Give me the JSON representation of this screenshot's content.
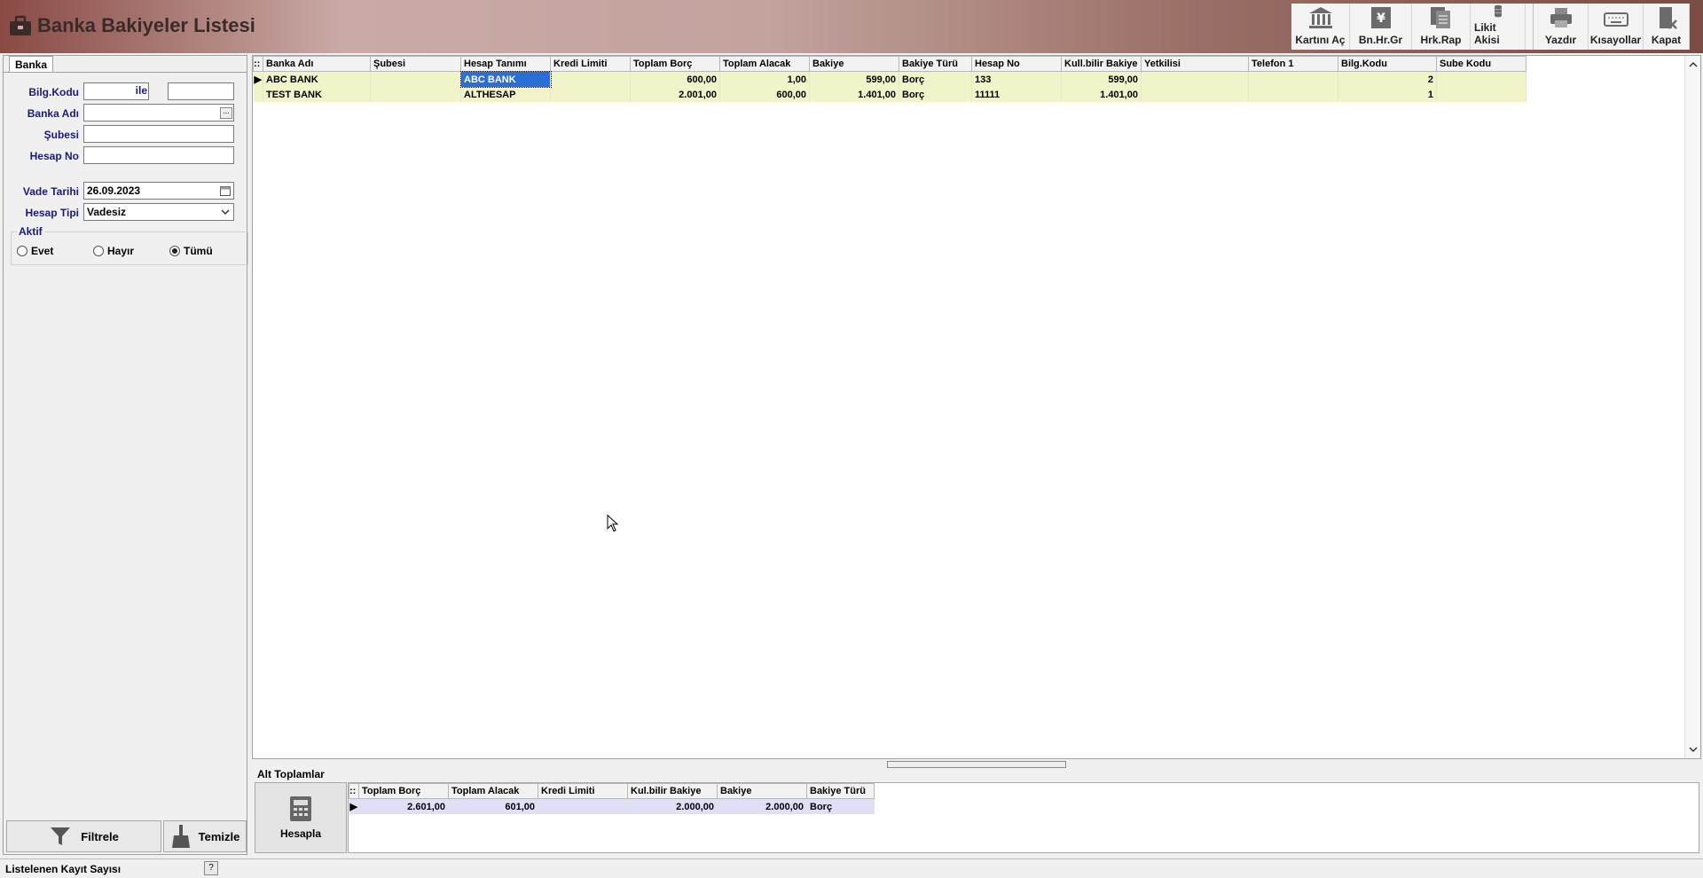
{
  "window": {
    "title": "Banka Bakiyeler Listesi"
  },
  "toolbar": {
    "items": [
      {
        "label": "Kartını Aç",
        "icon": "bank-icon"
      },
      {
        "label": "Bn.Hr.Gr",
        "icon": "yen-document-icon"
      },
      {
        "label": "Hrk.Rap",
        "icon": "report-icon"
      },
      {
        "label": "Likit Akisi",
        "icon": "coins-icon"
      },
      {
        "label": "Yazdır",
        "icon": "printer-icon"
      },
      {
        "label": "Kısayollar",
        "icon": "keyboard-icon"
      },
      {
        "label": "Kapat",
        "icon": "close-door-icon"
      }
    ]
  },
  "filter": {
    "tab": "Banka",
    "bilg_kodu_label": "Bilg.Kodu",
    "ile_label": "ile",
    "banka_adi_label": "Banka Adı",
    "subesi_label": "Şubesi",
    "hesap_no_label": "Hesap No",
    "vade_tarihi_label": "Vade Tarihi",
    "vade_tarihi_value": "26.09.2023",
    "hesap_tipi_label": "Hesap Tipi",
    "hesap_tipi_value": "Vadesiz",
    "aktif_label": "Aktif",
    "aktif_options": [
      "Evet",
      "Hayır",
      "Tümü"
    ],
    "aktif_selected": "Tümü",
    "filtrele_label": "Filtrele",
    "temizle_label": "Temizle",
    "browse_glyph": "..."
  },
  "grid": {
    "columns": [
      "Banka Adı",
      "Şubesi",
      "Hesap Tanımı",
      "Kredi Limiti",
      "Toplam Borç",
      "Toplam Alacak",
      "Bakiye",
      "Bakiye Türü",
      "Hesap No",
      "Kull.bilir Bakiye",
      "Yetkilisi",
      "Telefon 1",
      "Bilg.Kodu",
      "Sube Kodu"
    ],
    "rows": [
      [
        "ABC BANK",
        "",
        "ABC BANK",
        "",
        "600,00",
        "1,00",
        "599,00",
        "Borç",
        "133",
        "599,00",
        "",
        "",
        "2",
        ""
      ],
      [
        "TEST BANK",
        "",
        "ALTHESAP",
        "",
        "2.001,00",
        "600,00",
        "1.401,00",
        "Borç",
        "11111",
        "1.401,00",
        "",
        "",
        "1",
        ""
      ]
    ]
  },
  "totals": {
    "title": "Alt Toplamlar",
    "hesapla_label": "Hesapla",
    "columns": [
      "Toplam Borç",
      "Toplam Alacak",
      "Kredi Limiti",
      "Kul.bilir Bakiye",
      "Bakiye",
      "Bakiye Türü"
    ],
    "row": [
      "2.601,00",
      "601,00",
      "",
      "2.000,00",
      "2.000,00",
      "Borç"
    ]
  },
  "status": {
    "record_count_label": "Listelenen Kayıt Sayısı",
    "help": "?"
  }
}
